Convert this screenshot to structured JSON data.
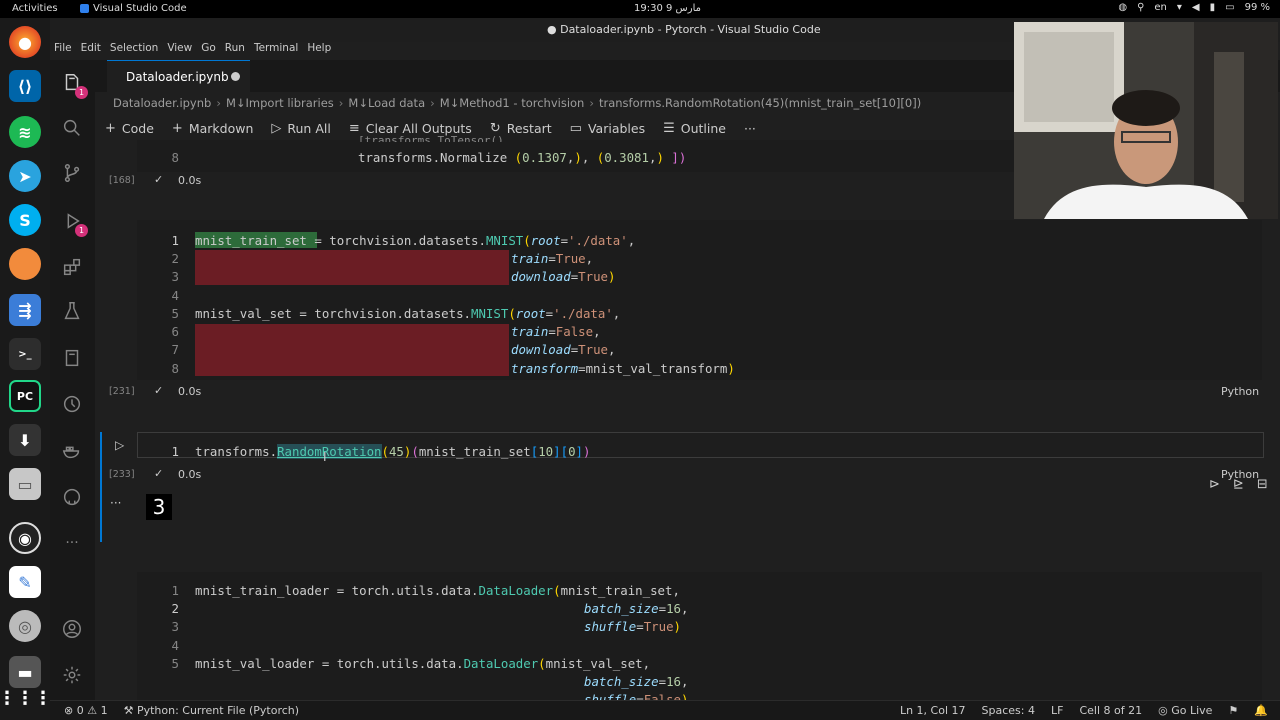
{
  "system": {
    "activities": "Activities",
    "app_name": "Visual Studio Code",
    "clock": "19:30 مارس 9",
    "language": "en",
    "battery": "99 %"
  },
  "window": {
    "title": "● Dataloader.ipynb - Pytorch - Visual Studio Code"
  },
  "menu": [
    "File",
    "Edit",
    "Selection",
    "View",
    "Go",
    "Run",
    "Terminal",
    "Help"
  ],
  "tab": {
    "label": "Dataloader.ipynb"
  },
  "breadcrumb": [
    "Dataloader.ipynb",
    "M↓Import libraries",
    "M↓Load data",
    "M↓Method1 - torchvision",
    "transforms.RandomRotation(45)(mnist_train_set[10][0])"
  ],
  "toolbar": {
    "code": "Code",
    "markdown": "Markdown",
    "run_all": "Run All",
    "clear": "Clear All Outputs",
    "restart": "Restart",
    "variables": "Variables",
    "outline": "Outline",
    "more": "···"
  },
  "cells": {
    "c1": {
      "line8_num": "8",
      "line8_code": "transforms.Normalize (0.1307,), (0.3081,) ])",
      "exec": "[168]",
      "dur": "0.0s"
    },
    "c2": {
      "exec": "[231]",
      "dur": "0.0s",
      "lang": "Python"
    },
    "c3": {
      "exec": "[233]",
      "dur": "0.0s",
      "lang": "Python",
      "output": "3",
      "output_more": "···"
    },
    "c4": {}
  },
  "status": {
    "problems": "⊗ 0 ⚠ 1",
    "interpreter": "Python: Current File (Pytorch)",
    "position": "Ln 1, Col 17",
    "spaces": "Spaces: 4",
    "eol": "LF",
    "cell": "Cell 8 of 21",
    "golive": "Go Live"
  },
  "colors": {
    "accent": "#0078d4",
    "deleted_line": "#6b1d24",
    "highlight": "#2d6b3a"
  }
}
